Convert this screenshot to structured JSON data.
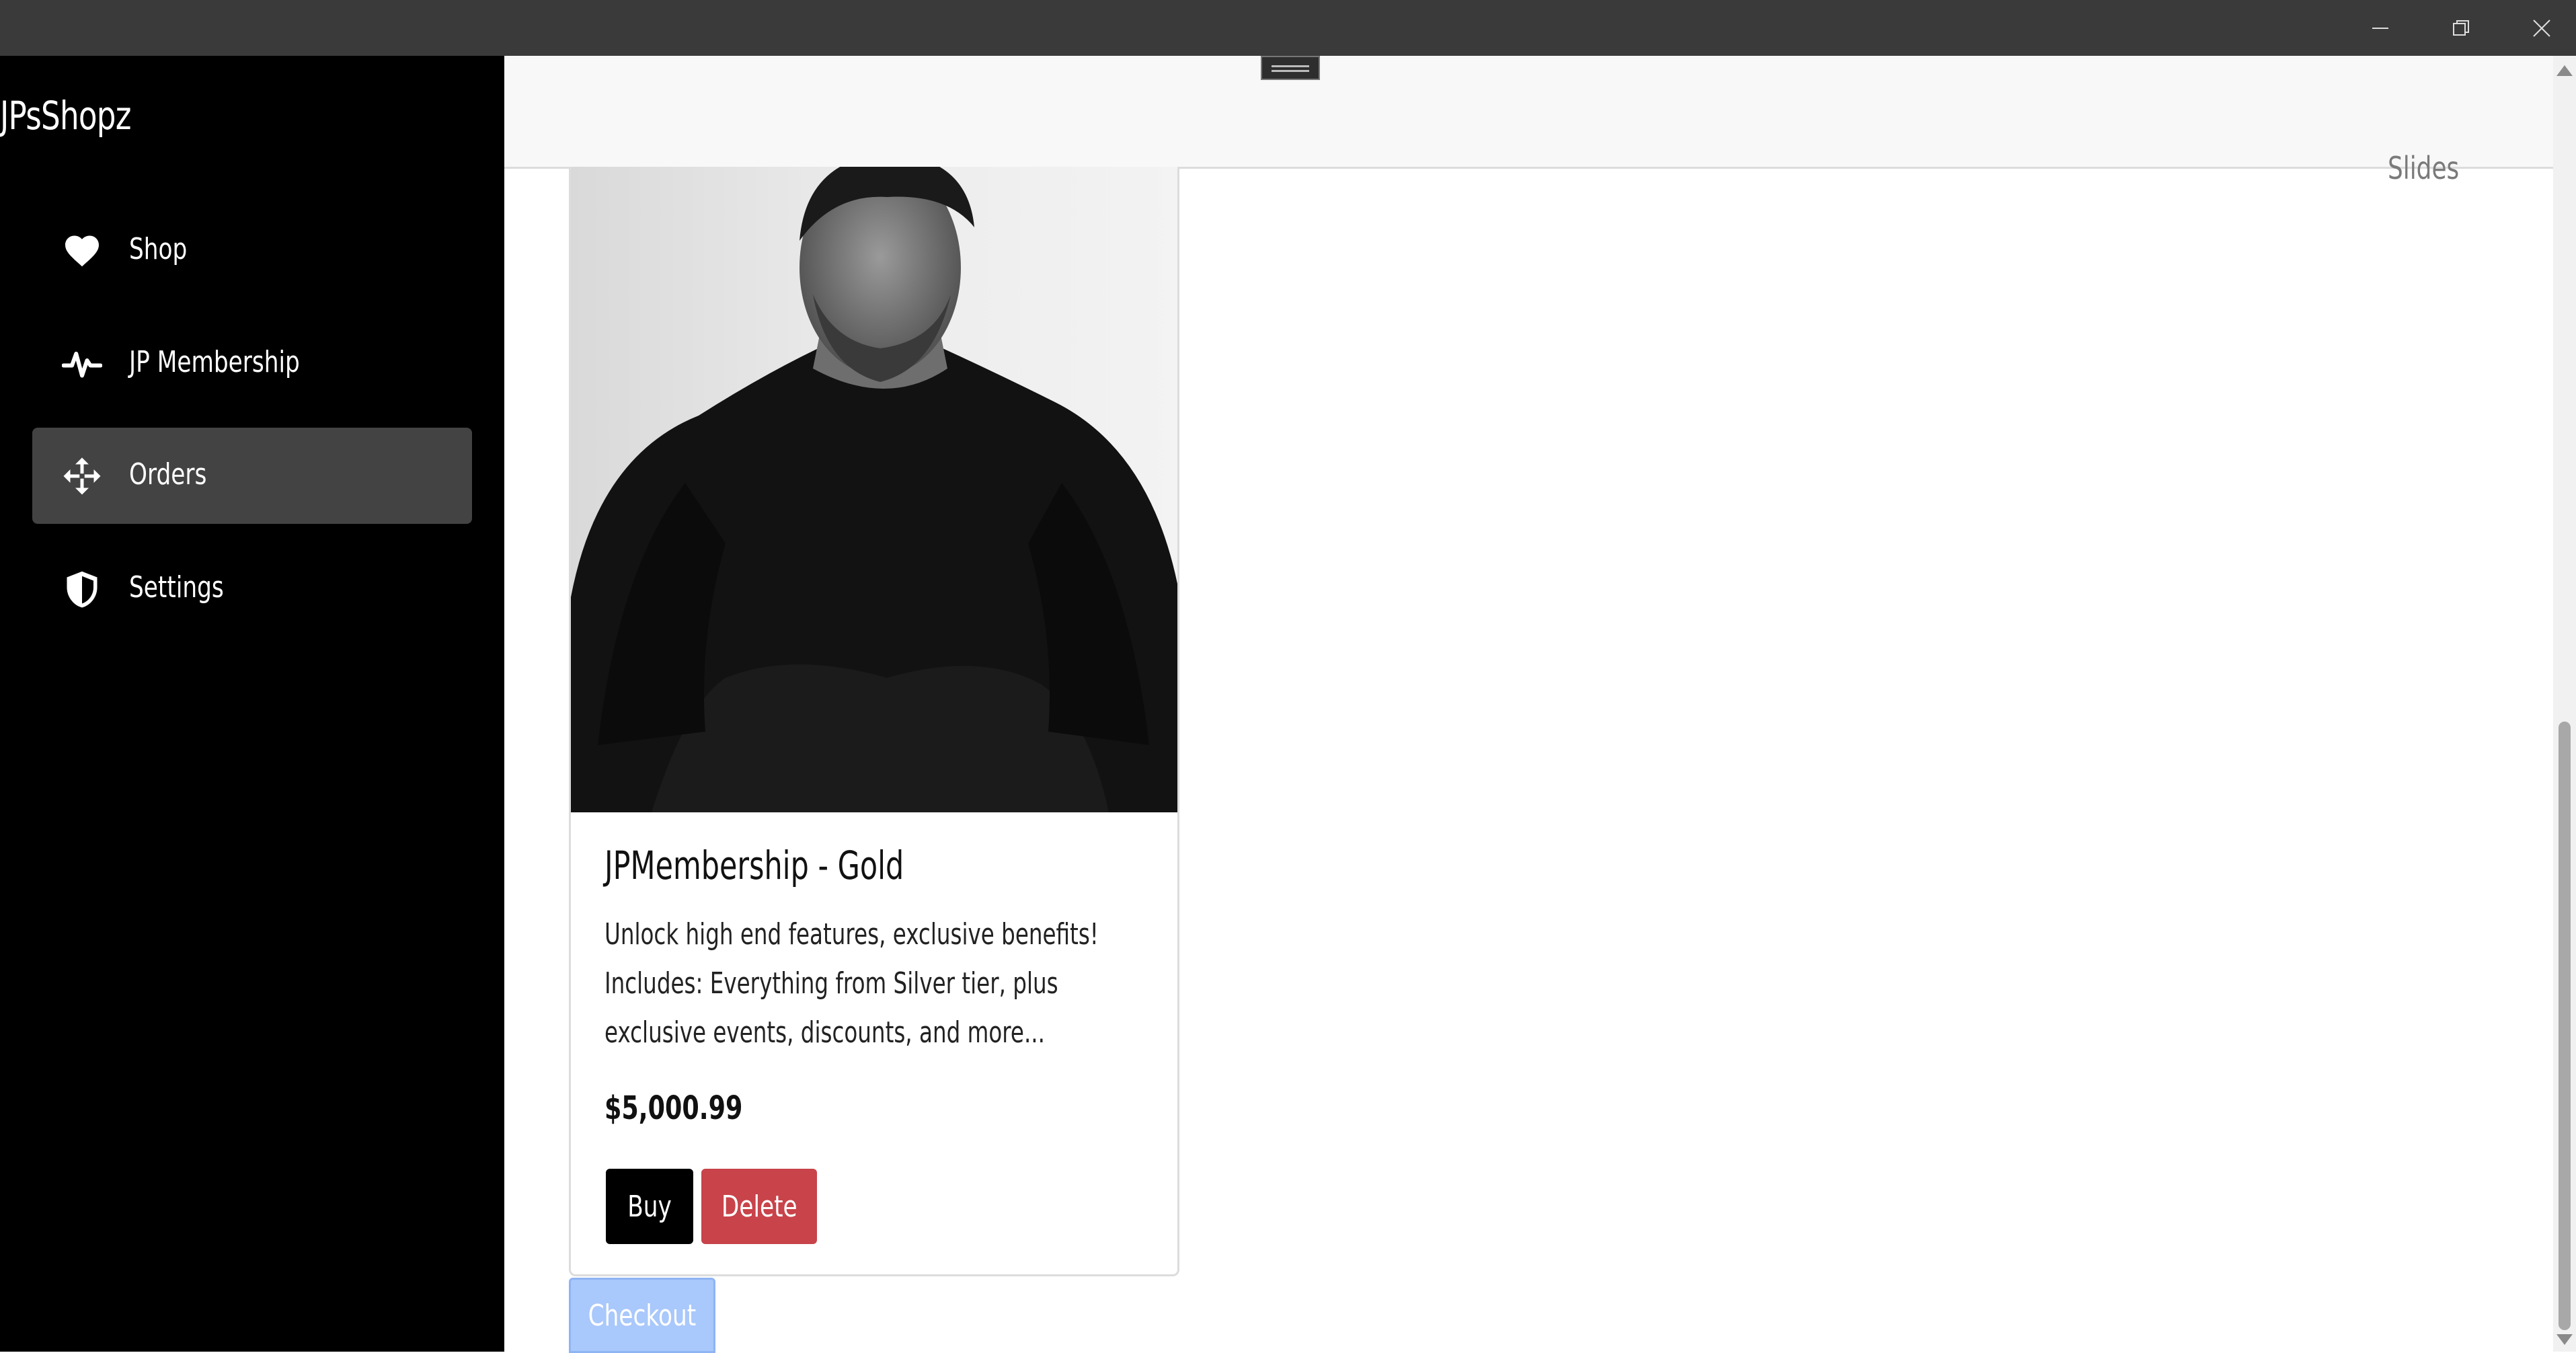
{
  "window": {
    "controls": [
      "minimize-icon",
      "restore-icon",
      "close-icon"
    ]
  },
  "sidebar": {
    "brand": "JPsShopz",
    "items": [
      {
        "label": "Shop",
        "icon": "heart-icon"
      },
      {
        "label": "JP Membership",
        "icon": "pulse-icon"
      },
      {
        "label": "Orders",
        "icon": "move-arrows-icon",
        "active": true
      },
      {
        "label": "Settings",
        "icon": "shield-icon"
      }
    ]
  },
  "header": {
    "slides_label": "Slides"
  },
  "product": {
    "title": "JPMembership - Gold",
    "description": "Unlock high end features, exclusive benefits! Includes: Everything from Silver tier, plus exclusive events, discounts, and more...",
    "price": "$5,000.99",
    "buy_label": "Buy",
    "delete_label": "Delete"
  },
  "checkout_label": "Checkout",
  "colors": {
    "sidebar_bg": "#000000",
    "active_item_bg": "#434343",
    "delete_button": "#c8434a",
    "checkout_button": "#a9c8fb"
  }
}
